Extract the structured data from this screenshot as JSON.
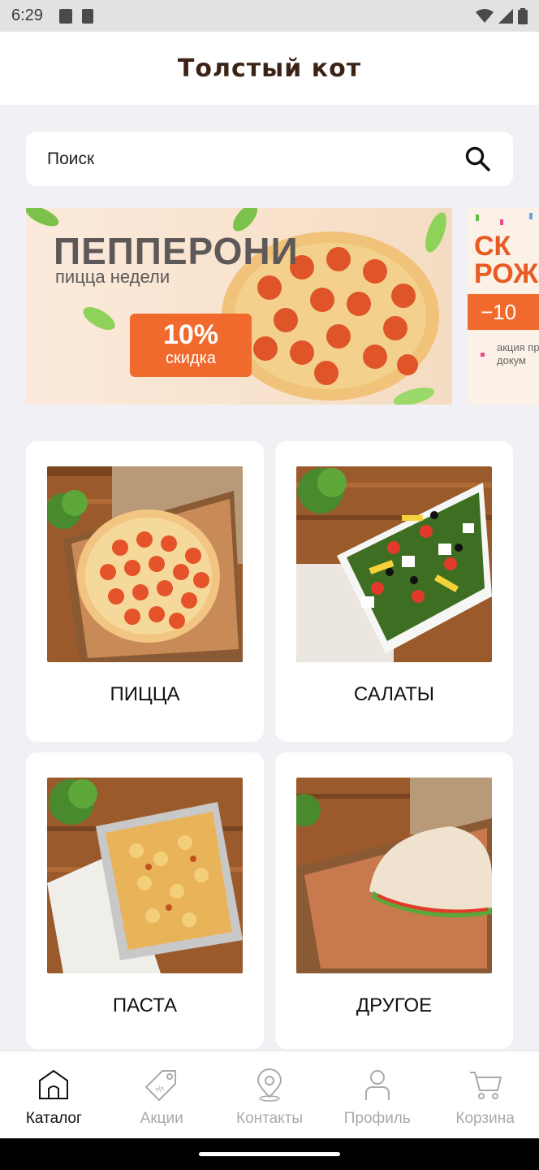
{
  "status_bar": {
    "time": "6:29"
  },
  "header": {
    "title": "Толстый кот"
  },
  "search": {
    "placeholder": "Поиск"
  },
  "banners": [
    {
      "title": "ПЕППЕРОНИ",
      "subtitle": "пицца недели",
      "discount": "10%",
      "discount_label": "скидка"
    },
    {
      "title_line1": "СК",
      "title_line2": "РОЖ",
      "discount": "−10",
      "text": "акция при пр докум"
    }
  ],
  "categories": [
    {
      "label": "ПИЦЦА",
      "image_icon": "pizza-photo"
    },
    {
      "label": "САЛАТЫ",
      "image_icon": "salad-photo"
    },
    {
      "label": "ПАСТА",
      "image_icon": "pasta-photo"
    },
    {
      "label": "ДРУГОЕ",
      "image_icon": "calzone-photo"
    }
  ],
  "bottom_nav": [
    {
      "label": "Каталог",
      "icon": "home-icon",
      "active": true
    },
    {
      "label": "Акции",
      "icon": "tag-icon",
      "active": false
    },
    {
      "label": "Контакты",
      "icon": "location-pin-icon",
      "active": false
    },
    {
      "label": "Профиль",
      "icon": "person-icon",
      "active": false
    },
    {
      "label": "Корзина",
      "icon": "cart-icon",
      "active": false
    }
  ],
  "colors": {
    "accent": "#f06a2e",
    "title": "#3b2416",
    "background": "#f1f1f5"
  }
}
